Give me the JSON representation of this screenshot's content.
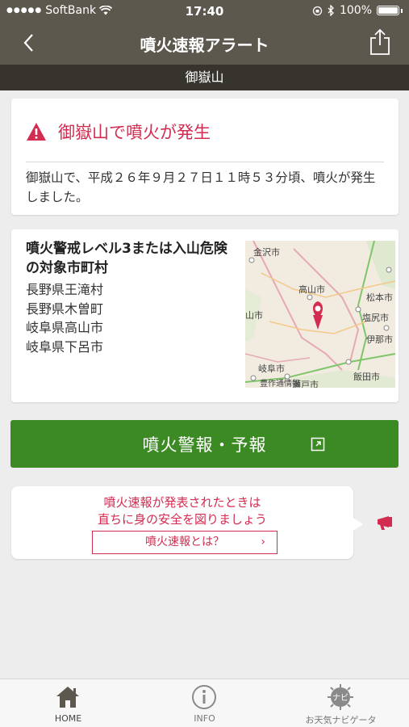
{
  "status_bar": {
    "carrier": "SoftBank",
    "time": "17:40",
    "battery": "100%"
  },
  "nav": {
    "title": "噴火速報アラート",
    "back_icon": "chevron-left-icon",
    "share_icon": "share-icon"
  },
  "subheader": {
    "volcano": "御嶽山"
  },
  "alert": {
    "icon": "warning-triangle-icon",
    "headline": "御嶽山で噴火が発生",
    "body": "御嶽山で、平成２６年９月２７日１１時５３分頃、噴火が発生しました。"
  },
  "affected": {
    "title": "噴火警戒レベル3または入山危険の対象市町村",
    "municipalities": [
      "長野県王滝村",
      "長野県木曽町",
      "岐阜県高山市",
      "岐阜県下呂市"
    ],
    "map_labels": [
      "金沢市",
      "高山市",
      "松本市",
      "山市",
      "塩尻市",
      "伊那市",
      "岐阜市",
      "飯田市",
      "瀬戸市",
      "豊作通情報"
    ]
  },
  "warning_button": {
    "label": "噴火警報・予報",
    "icon": "external-link-icon"
  },
  "bubble": {
    "line1": "噴火速報が発表されたときは",
    "line2": "直ちに身の安全を図りましょう",
    "link_label": "噴火速報とは？",
    "link_chevron": "›"
  },
  "tabs": [
    {
      "label": "HOME",
      "icon": "home-icon"
    },
    {
      "label": "INFO",
      "icon": "info-icon"
    },
    {
      "label": "お天気ナビゲータ",
      "icon": "navi-icon",
      "badge": "ナビ"
    }
  ],
  "colors": {
    "header": "#5d584e",
    "subheader": "#37342e",
    "alert_red": "#d22c50",
    "green": "#3c8a24"
  }
}
